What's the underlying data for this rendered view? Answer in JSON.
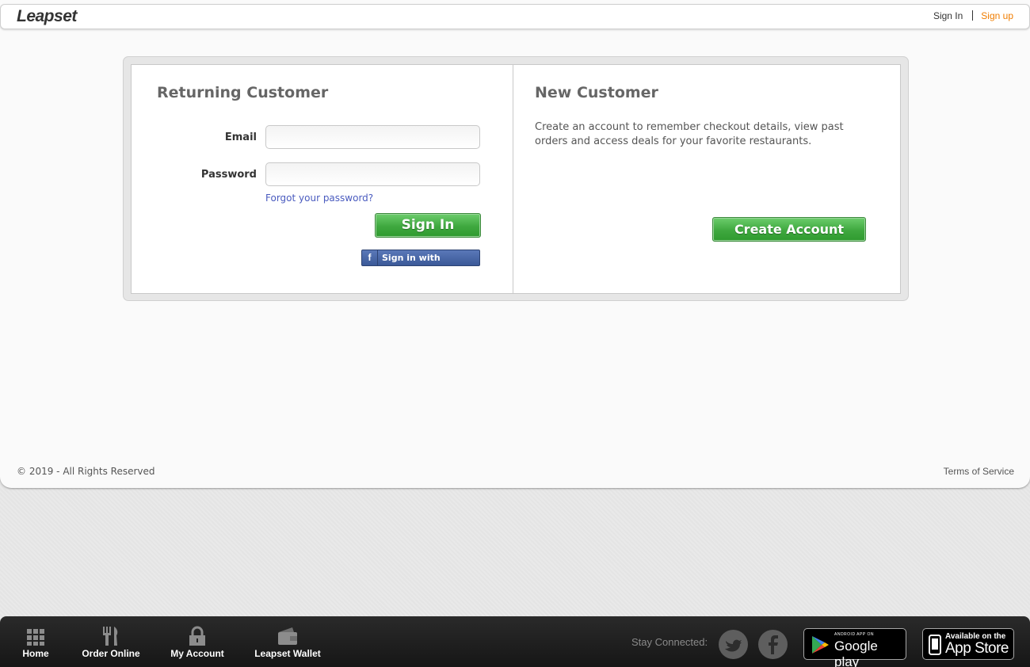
{
  "header": {
    "logo": "Leapset",
    "signin_label": "Sign In",
    "signup_label": "Sign up"
  },
  "returning": {
    "title": "Returning Customer",
    "email_label": "Email",
    "email_value": "",
    "password_label": "Password",
    "password_value": "",
    "forgot_label": "Forgot your password?",
    "signin_button": "Sign In",
    "facebook_button": "Sign in with Facebook"
  },
  "new_customer": {
    "title": "New Customer",
    "description": "Create an account to remember checkout details, view past orders and access deals for your favorite restaurants.",
    "create_button": "Create Account"
  },
  "page_footer": {
    "copyright": "© 2019 - All Rights Reserved",
    "terms": "Terms of Service"
  },
  "bottom_nav": {
    "items": [
      {
        "label": "Home",
        "icon": "grid-icon"
      },
      {
        "label": "Order Online",
        "icon": "fork-knife-icon"
      },
      {
        "label": "My Account",
        "icon": "lock-icon"
      },
      {
        "label": "Leapset Wallet",
        "icon": "wallet-icon"
      }
    ],
    "stay_connected": "Stay Connected:",
    "google_play_small": "ANDROID APP ON",
    "google_play_big": "Google play",
    "app_store_small": "Available on the",
    "app_store_big": "App Store"
  },
  "colors": {
    "accent_orange": "#f07d00",
    "green_button": "#3fa83f",
    "facebook_blue": "#3b5998",
    "link_blue": "#4a5bbf"
  }
}
